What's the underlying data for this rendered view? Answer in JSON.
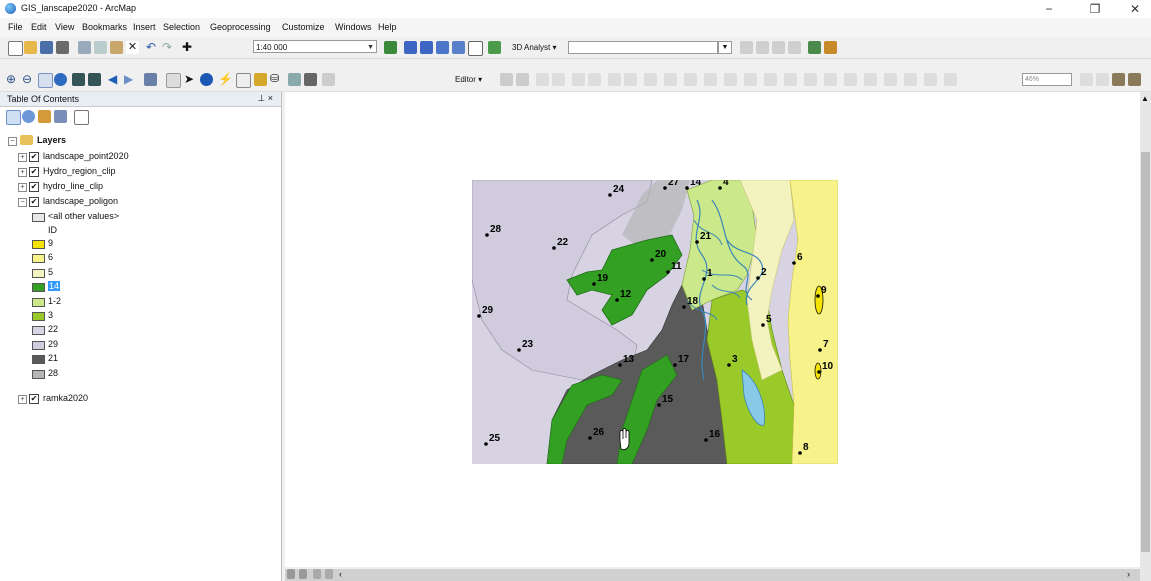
{
  "window": {
    "title": "GIS_lanscape2020 - ArcMap",
    "minimize": "−",
    "restore": "❐",
    "close": "✕"
  },
  "menu": [
    "File",
    "Edit",
    "View",
    "Bookmarks",
    "Insert",
    "Selection",
    "Geoprocessing",
    "Customize",
    "Windows",
    "Help"
  ],
  "toolbar": {
    "scale": "1:40 000",
    "analyst_label": "3D Analyst ▾",
    "editor_label": "Editor ▾",
    "zoom_level": "46%"
  },
  "toc": {
    "title": "Table Of Contents",
    "pin": "⊥ ×",
    "layers_label": "Layers",
    "layers": [
      "landscape_point2020",
      "Hydro_region_clip",
      "hydro_line_clip",
      "landscape_poligon"
    ],
    "legend_header": "<all other values>",
    "legend_field": "ID",
    "legend": [
      {
        "label": "9",
        "color": "#f5e400"
      },
      {
        "label": "6",
        "color": "#f7f28a"
      },
      {
        "label": "5",
        "color": "#f3f3c0"
      },
      {
        "label": "14",
        "color": "#33a024"
      },
      {
        "label": "1-2",
        "color": "#cbe88a"
      },
      {
        "label": "3",
        "color": "#9ac92a"
      },
      {
        "label": "22",
        "color": "#d7d3e3"
      },
      {
        "label": "29",
        "color": "#d0cbdd"
      },
      {
        "label": "21",
        "color": "#5a5a5a"
      },
      {
        "label": "28",
        "color": "#b5b5b5"
      }
    ],
    "extra_layer": "ramka2020"
  },
  "map": {
    "points": [
      {
        "label": "24"
      },
      {
        "label": "27"
      },
      {
        "label": "14"
      },
      {
        "label": "4"
      },
      {
        "label": "28"
      },
      {
        "label": "22"
      },
      {
        "label": "21"
      },
      {
        "label": "20"
      },
      {
        "label": "6"
      },
      {
        "label": "19"
      },
      {
        "label": "11"
      },
      {
        "label": "1"
      },
      {
        "label": "2"
      },
      {
        "label": "12"
      },
      {
        "label": "9"
      },
      {
        "label": "29"
      },
      {
        "label": "18"
      },
      {
        "label": "5"
      },
      {
        "label": "7"
      },
      {
        "label": "23"
      },
      {
        "label": "3"
      },
      {
        "label": "13"
      },
      {
        "label": "17"
      },
      {
        "label": "10"
      },
      {
        "label": "15"
      },
      {
        "label": "25"
      },
      {
        "label": "26"
      },
      {
        "label": "16"
      },
      {
        "label": "8"
      }
    ]
  }
}
